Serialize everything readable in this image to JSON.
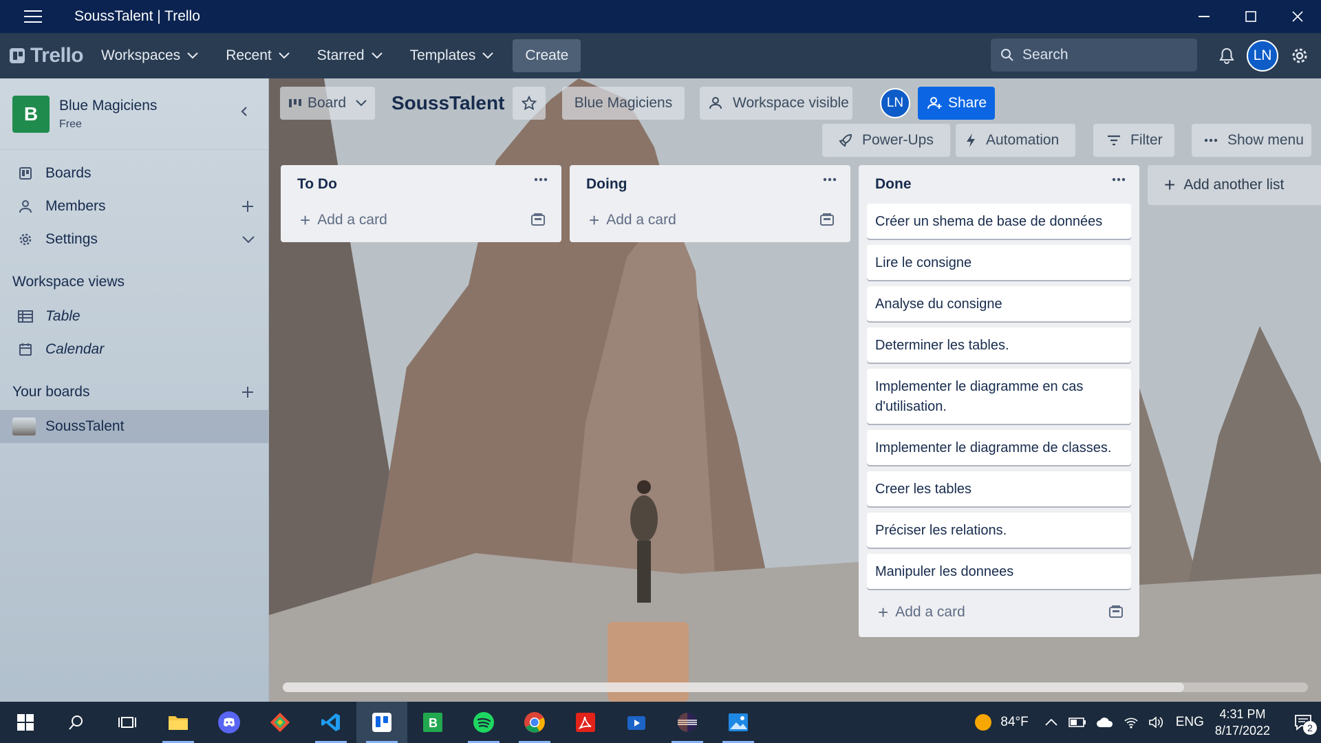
{
  "window": {
    "title": "SoussTalent | Trello"
  },
  "navbar": {
    "logo": "Trello",
    "menus": [
      "Workspaces",
      "Recent",
      "Starred",
      "Templates"
    ],
    "create_label": "Create",
    "search_placeholder": "Search",
    "avatar_initials": "LN"
  },
  "sidebar": {
    "workspace_letter": "B",
    "workspace_name": "Blue Magiciens",
    "plan": "Free",
    "items": [
      "Boards",
      "Members",
      "Settings"
    ],
    "views_header": "Workspace views",
    "views": [
      "Table",
      "Calendar"
    ],
    "boards_header": "Your boards",
    "boards": [
      "SoussTalent"
    ]
  },
  "board_header": {
    "view_label": "Board",
    "title": "SoussTalent",
    "workspace_label": "Blue Magiciens",
    "visibility_label": "Workspace visible",
    "member_initials": "LN",
    "share_label": "Share",
    "powerups_label": "Power-Ups",
    "automation_label": "Automation",
    "filter_label": "Filter",
    "show_menu_label": "Show menu"
  },
  "lists": [
    {
      "title": "To Do",
      "cards": [],
      "add_card_label": "Add a card"
    },
    {
      "title": "Doing",
      "cards": [],
      "add_card_label": "Add a card"
    },
    {
      "title": "Done",
      "cards": [
        "Créer un shema de base de données",
        "Lire le consigne",
        "Analyse du consigne",
        "Determiner les tables.",
        "Implementer le diagramme en cas d'utilisation.",
        "Implementer le diagramme de classes.",
        "Creer les tables",
        "Préciser les relations.",
        "Manipuler les donnees"
      ],
      "add_card_label": "Add a card"
    }
  ],
  "add_list_label": "Add another list",
  "taskbar": {
    "apps": [
      "start",
      "search",
      "task-view",
      "file-explorer",
      "discord",
      "git",
      "vs-code",
      "trello",
      "board-app",
      "spotify",
      "chrome",
      "acrobat",
      "media-player",
      "eclipse",
      "photos"
    ],
    "weather": "84°F",
    "language": "ENG",
    "time": "4:31 PM",
    "date": "8/17/2022",
    "notification_count": "2"
  }
}
